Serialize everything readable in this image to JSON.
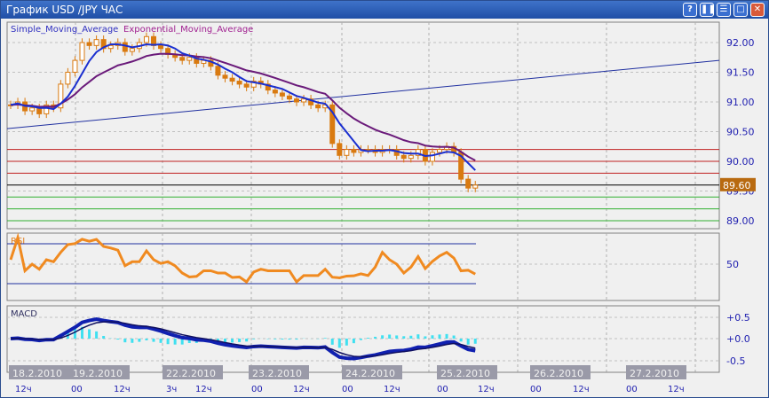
{
  "window": {
    "title": "График USD /JPY  ЧАС",
    "buttons": [
      {
        "name": "help",
        "glyph": "?"
      },
      {
        "name": "pause",
        "glyph": "❚❚"
      },
      {
        "name": "menu",
        "glyph": "☰"
      },
      {
        "name": "maximize",
        "glyph": "□"
      },
      {
        "name": "close",
        "glyph": "✕"
      }
    ]
  },
  "main": {
    "legend_sma": "Simple_Moving_Average",
    "legend_ema": "Exponential_Moving_Average",
    "price_ticks": [
      "92.00",
      "91.50",
      "91.00",
      "90.50",
      "90.00",
      "89.50",
      "89.00"
    ],
    "current_price": "89.60",
    "levels_red": [
      90.2,
      90.0,
      89.8
    ],
    "level_black": 89.6,
    "levels_green": [
      89.4,
      89.2,
      89.0
    ],
    "trendline": [
      90.55,
      91.7
    ],
    "closes": [
      90.95,
      91.0,
      90.85,
      90.9,
      90.8,
      90.95,
      90.9,
      91.3,
      91.5,
      91.7,
      92.0,
      91.95,
      92.05,
      91.9,
      91.95,
      92.0,
      91.85,
      91.9,
      92.0,
      92.1,
      91.95,
      91.9,
      91.8,
      91.75,
      91.7,
      91.75,
      91.65,
      91.7,
      91.6,
      91.45,
      91.4,
      91.35,
      91.3,
      91.25,
      91.35,
      91.3,
      91.2,
      91.15,
      91.1,
      91.05,
      91.0,
      91.05,
      90.95,
      90.9,
      90.95,
      90.3,
      90.1,
      90.2,
      90.15,
      90.2,
      90.2,
      90.15,
      90.2,
      90.2,
      90.1,
      90.05,
      90.1,
      90.2,
      90.0,
      90.15,
      90.2,
      90.25,
      90.15,
      89.7,
      89.55,
      89.6
    ]
  },
  "rsi": {
    "label": "RSI",
    "tick": "50"
  },
  "macd": {
    "label": "MACD",
    "ticks": [
      "+0.5",
      "+0.0",
      "-0.5"
    ]
  },
  "dates": [
    "18.2.2010",
    "19.2.2010",
    "22.2.2010",
    "23.2.2010",
    "24.2.2010",
    "25.2.2010",
    "26.2.2010",
    "27.2.2010"
  ],
  "times": [
    "12ч",
    "00",
    "12ч",
    "3ч",
    "12ч",
    "00",
    "12ч",
    "00",
    "12ч",
    "00",
    "12ч",
    "00",
    "12ч",
    "00",
    "12ч"
  ],
  "colors": {
    "candle": "#d97a10",
    "sma": "#1a2fd0",
    "ema": "#6a1a7a",
    "rsi": "#f08a20",
    "macd": "#1020b0",
    "hist": "#40e0f0"
  }
}
